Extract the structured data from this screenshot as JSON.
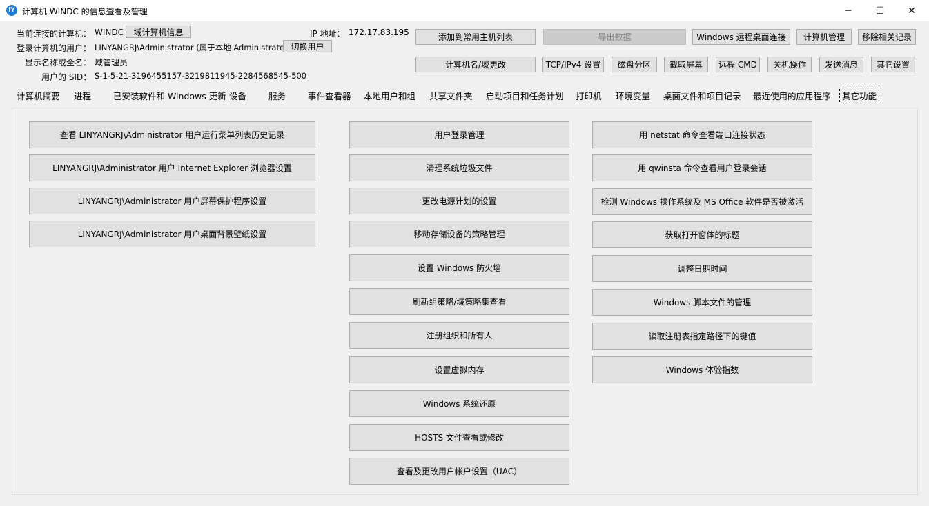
{
  "window": {
    "title": "计算机 WINDC 的信息查看及管理",
    "icon_glyph": "iY",
    "minimize": "─",
    "maximize": "☐",
    "close": "✕"
  },
  "info": {
    "computer_label": "当前连接的计算机：",
    "computer_value": "WINDC",
    "domain_info_button": "域计算机信息",
    "ip_label": "IP 地址：",
    "ip_value": "172.17.83.195",
    "user_label": "登录计算机的用户：",
    "user_value": "LINYANGRJ\\Administrator (属于本地 Administrators 组)",
    "switch_user_button": "切换用户",
    "display_name_label": "显示名称或全名：",
    "display_name_value": "域管理员",
    "sid_label": "用户的 SID：",
    "sid_value": "S-1-5-21-3196455157-3219811945-2284568545-500"
  },
  "toolbar": {
    "add_to_list": "添加到常用主机列表",
    "export_data": "导出数据",
    "remote_desktop": "Windows 远程桌面连接",
    "computer_manage": "计算机管理",
    "remove_records": "移除相关记录",
    "rename_computer": "计算机名/域更改",
    "tcp_settings": "TCP/IPv4 设置",
    "disk_partition": "磁盘分区",
    "screenshot": "截取屏幕",
    "remote_cmd": "远程 CMD",
    "shutdown": "关机操作",
    "send_message": "发送消息",
    "other_settings": "其它设置"
  },
  "tabs": [
    "计算机摘要",
    "进程",
    "已安装软件和 Windows 更新",
    "设备",
    "服务",
    "事件查看器",
    "本地用户和组",
    "共享文件夹",
    "启动项目和任务计划",
    "打印机",
    "环境变量",
    "桌面文件和项目记录",
    "最近使用的应用程序",
    "其它功能"
  ],
  "functions": {
    "col1": [
      "查看 LINYANGRJ\\Administrator 用户运行菜单列表历史记录",
      "LINYANGRJ\\Administrator 用户 Internet Explorer 浏览器设置",
      "LINYANGRJ\\Administrator 用户屏幕保护程序设置",
      "LINYANGRJ\\Administrator 用户桌面背景壁纸设置"
    ],
    "col2": [
      "用户登录管理",
      "清理系统垃圾文件",
      "更改电源计划的设置",
      "移动存储设备的策略管理",
      "设置 Windows 防火墙",
      "刷新组策略/域策略集查看",
      "注册组织和所有人",
      "设置虚拟内存",
      "Windows 系统还原",
      "HOSTS 文件查看或修改",
      "查看及更改用户帐户设置（UAC）"
    ],
    "col3": [
      "用 netstat 命令查看端口连接状态",
      "用 qwinsta 命令查看用户登录会话",
      "检测 Windows 操作系统及 MS Office 软件是否被激活",
      "获取打开窗体的标题",
      "调整日期时间",
      "Windows 脚本文件的管理",
      "读取注册表指定路径下的键值",
      "Windows 体验指数"
    ]
  }
}
